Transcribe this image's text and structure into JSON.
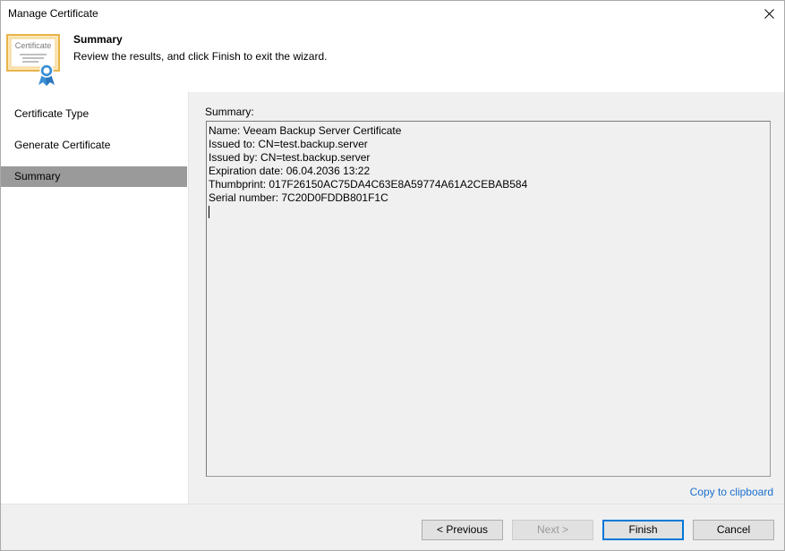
{
  "window": {
    "title": "Manage Certificate"
  },
  "header": {
    "icon_text": "Certificate",
    "title": "Summary",
    "description": "Review the results, and click Finish to exit the wizard."
  },
  "sidebar": {
    "items": [
      {
        "label": "Certificate Type",
        "active": false
      },
      {
        "label": "Generate Certificate",
        "active": false
      },
      {
        "label": "Summary",
        "active": true
      }
    ]
  },
  "summary": {
    "label": "Summary:",
    "lines": [
      "Name: Veeam Backup Server Certificate",
      "Issued to: CN=test.backup.server",
      "Issued by: CN=test.backup.server",
      "Expiration date: 06.04.2036 13:22",
      "Thumbprint: 017F26150AC75DA4C63E8A59774A61A2CEBAB584",
      "Serial number: 7C20D0FDDB801F1C"
    ],
    "copy_link": "Copy to clipboard"
  },
  "buttons": {
    "previous": "< Previous",
    "next": "Next >",
    "finish": "Finish",
    "cancel": "Cancel"
  },
  "colors": {
    "link": "#1a6fd0",
    "active_nav": "#9a9a9a",
    "certificate_frame": "#e8b44a",
    "ribbon": "#3a8fd6"
  }
}
